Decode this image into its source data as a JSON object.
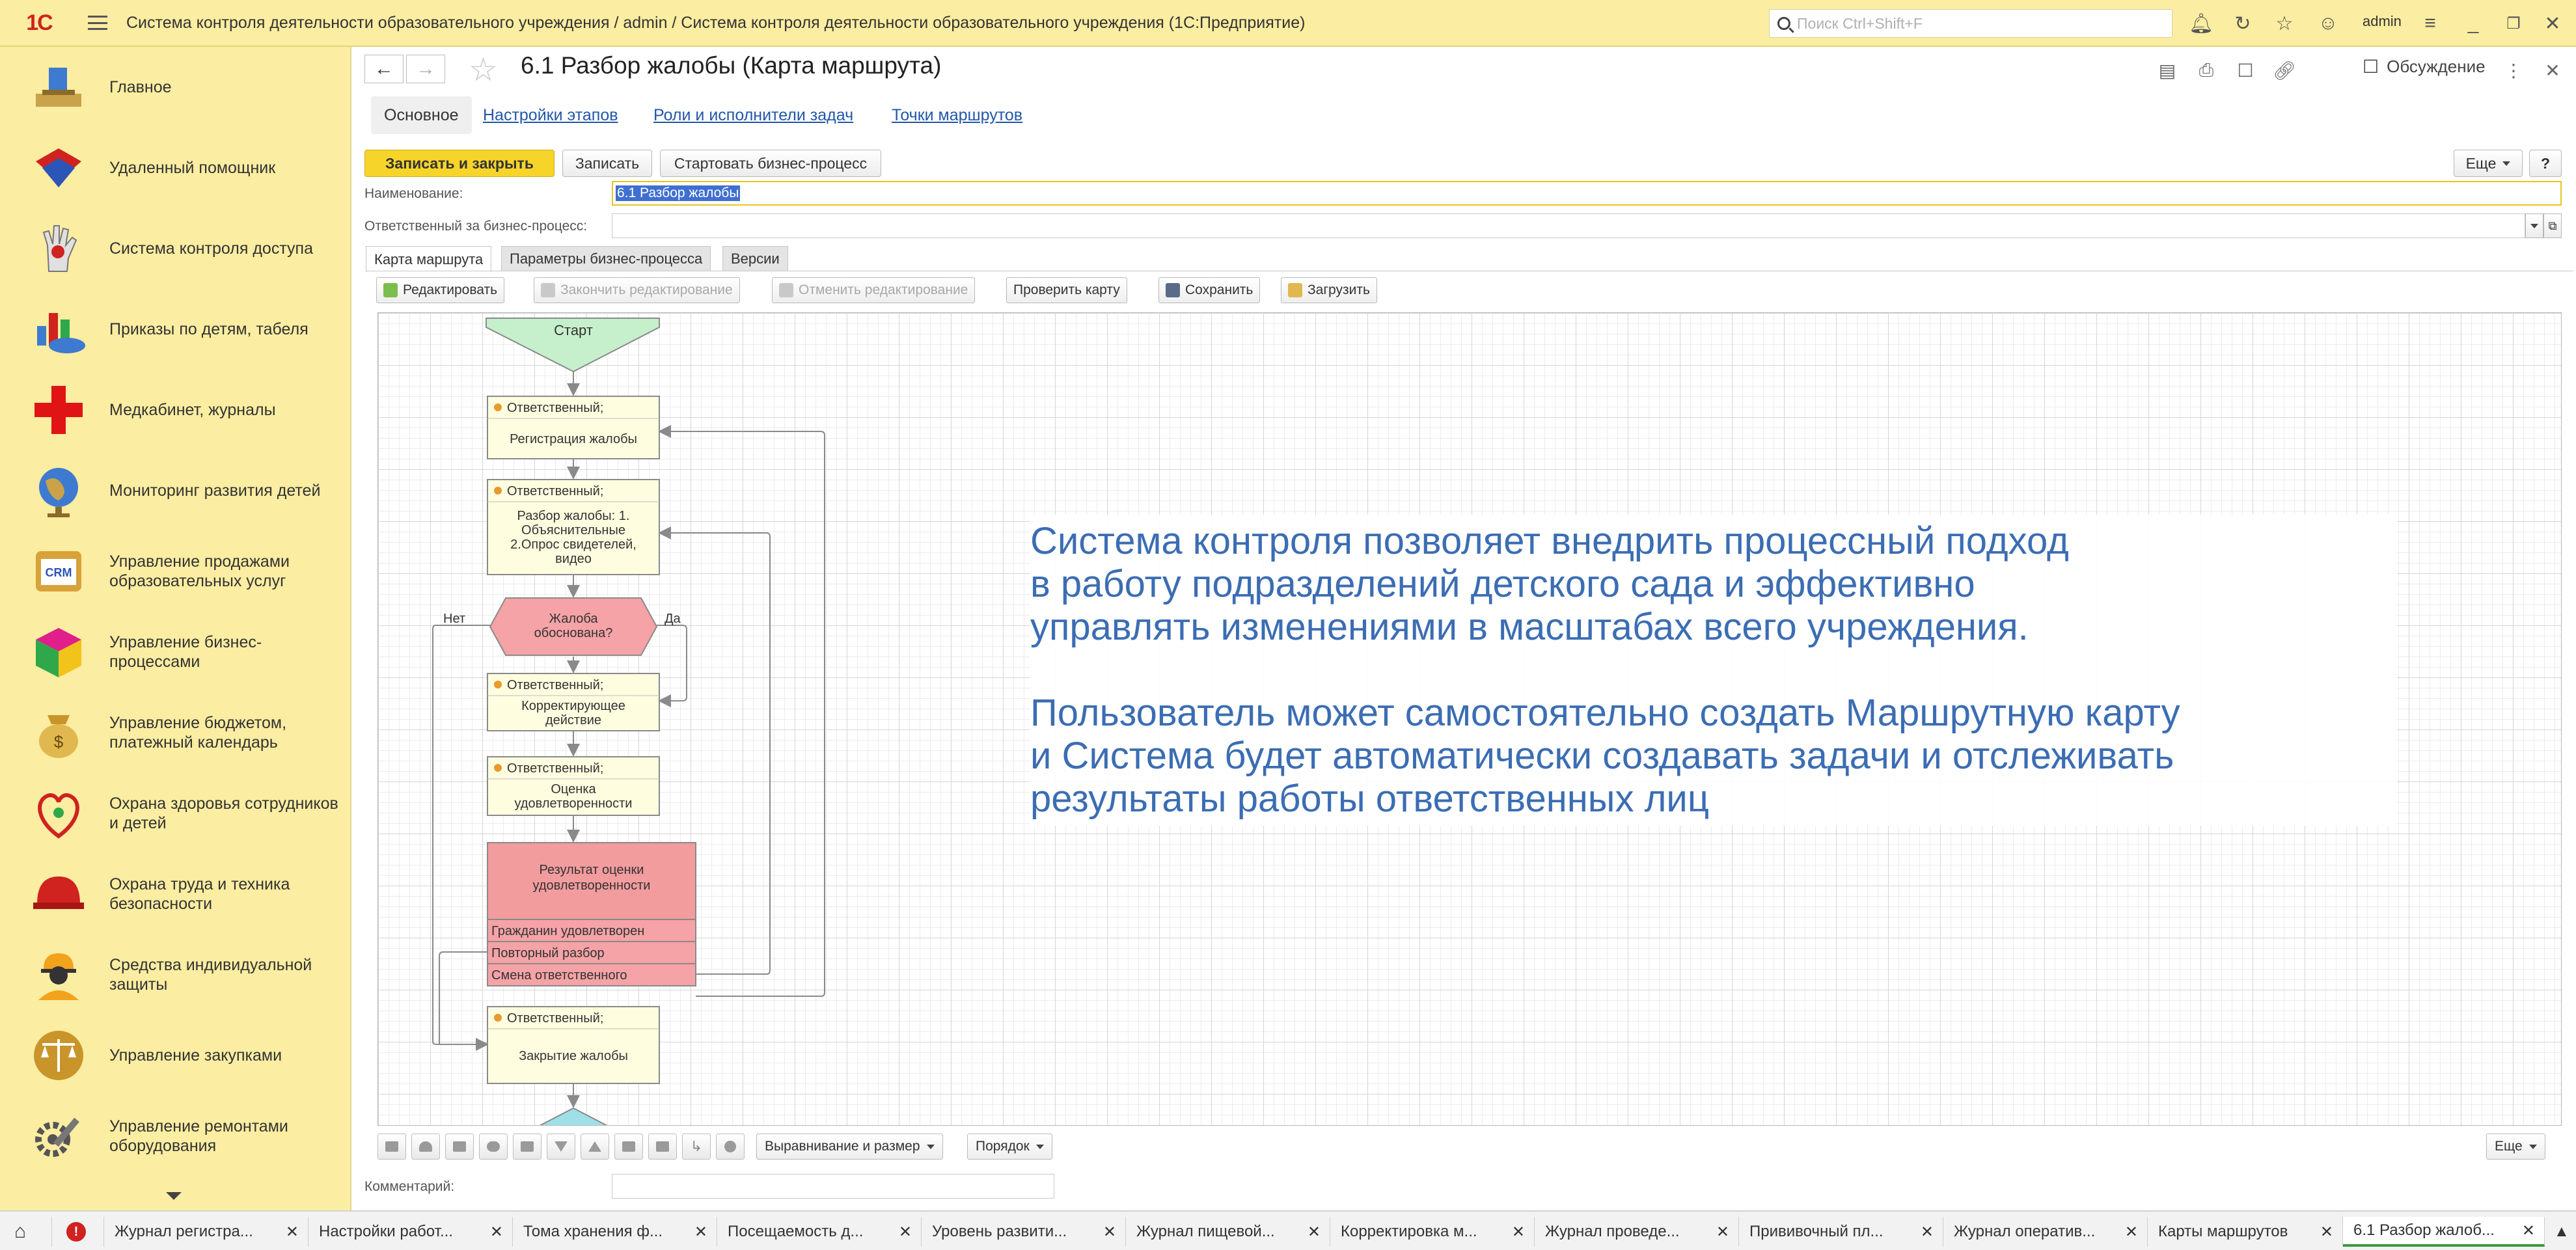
{
  "app": {
    "logo": "1С",
    "title": "Система контроля деятельности образовательного учреждения / admin / Система контроля деятельности образовательного учреждения  (1С:Предприятие)",
    "search_placeholder": "Поиск Ctrl+Shift+F",
    "user": "admin"
  },
  "sidebar": {
    "items": [
      {
        "label": "Главное",
        "icon": "desk-icon"
      },
      {
        "label": "Удаленный помощник",
        "icon": "remote-helper-icon"
      },
      {
        "label": "Система контроля доступа",
        "icon": "hand-icon"
      },
      {
        "label": "Приказы по детям, табеля",
        "icon": "chart-icon"
      },
      {
        "label": "Медкабинет, журналы",
        "icon": "red-cross-icon"
      },
      {
        "label": "Мониторинг развития детей",
        "icon": "globe-icon"
      },
      {
        "label": "Управление продажами образовательных услуг",
        "icon": "crm-icon"
      },
      {
        "label": "Управление бизнес-процессами",
        "icon": "cube-icon"
      },
      {
        "label": "Управление бюджетом, платежный календарь",
        "icon": "money-bag-icon"
      },
      {
        "label": "Охрана здоровья сотрудников и детей",
        "icon": "health-icon"
      },
      {
        "label": "Охрана труда и техника безопасности",
        "icon": "helmet-icon"
      },
      {
        "label": "Средства индивидуальной защиты",
        "icon": "worker-icon"
      },
      {
        "label": "Управление закупками",
        "icon": "scales-icon"
      },
      {
        "label": "Управление ремонтами оборудования",
        "icon": "gears-icon"
      }
    ]
  },
  "document": {
    "title": "6.1 Разбор жалобы (Карта маршрута)",
    "discuss_label": "Обсуждение",
    "tabs": [
      "Основное",
      "Настройки этапов",
      "Роли и исполнители задач",
      "Точки маршрутов"
    ],
    "buttons": {
      "save_close": "Записать и закрыть",
      "save": "Записать",
      "start": "Стартовать бизнес-процесс",
      "more": "Еще",
      "help": "?"
    },
    "fields": {
      "name_label": "Наименование:",
      "name_value": "6.1 Разбор жалобы",
      "responsible_label": "Ответственный за бизнес-процесс:",
      "responsible_value": "",
      "comment_label": "Комментарий:",
      "comment_value": ""
    },
    "inner_tabs": [
      "Карта маршрута",
      "Параметры бизнес-процесса",
      "Версии"
    ],
    "map_toolbar": [
      "Редактировать",
      "Закончить редактирование",
      "Отменить редактирование",
      "Проверить карту",
      "Сохранить",
      "Загрузить"
    ],
    "bottom_toolbar": {
      "align": "Выравнивание и размер",
      "order": "Порядок",
      "more": "Еще"
    }
  },
  "flowchart": {
    "start": "Старт",
    "role": "Ответственный;",
    "step1": "Регистрация жалобы",
    "step2": [
      "Разбор жалобы: 1.",
      "Объяснительные",
      "2.Опрос свидетелей,",
      "видео"
    ],
    "decision": [
      "Жалоба",
      "обоснована?"
    ],
    "no": "Нет",
    "yes": "Да",
    "step3": [
      "Корректирующее",
      "действие"
    ],
    "step4": [
      "Оценка",
      "удовлетворенности"
    ],
    "result": [
      "Результат оценки",
      "удовлетворенности"
    ],
    "options": [
      "Гражданин удовлетворен",
      "Повторный разбор",
      "Смена ответственного"
    ],
    "step5": "Закрытие жалобы"
  },
  "overlay": {
    "paragraph1": [
      "Система контроля позволяет внедрить процессный подход",
      "в работу подразделений детского сада и эффективно",
      "управлять изменениями в масштабах всего учреждения."
    ],
    "paragraph2": [
      "Пользователь может самостоятельно создать Маршрутную карту",
      "и Система будет автоматически создавать задачи и отслеживать",
      "результаты работы ответственных лиц"
    ]
  },
  "taskbar": {
    "items": [
      "Журнал регистра...",
      "Настройки работ...",
      "Тома хранения ф...",
      "Посещаемость д...",
      "Уровень развити...",
      "Журнал пищевой...",
      "Корректировка м...",
      "Журнал проведе...",
      "Прививочный пл...",
      "Журнал оператив...",
      "Карты маршрутов",
      "6.1 Разбор жалоб..."
    ],
    "active_index": 11
  },
  "colors": {
    "accent_yellow": "#fbeda1",
    "primary_button": "#f6d42a",
    "link_blue": "#2157a8",
    "overlay_text": "#3b6db3",
    "start_node": "#c6f0cc",
    "task_node": "#fffde0",
    "decision_node": "#f5a3a6",
    "result_node": "#f29c9e"
  }
}
